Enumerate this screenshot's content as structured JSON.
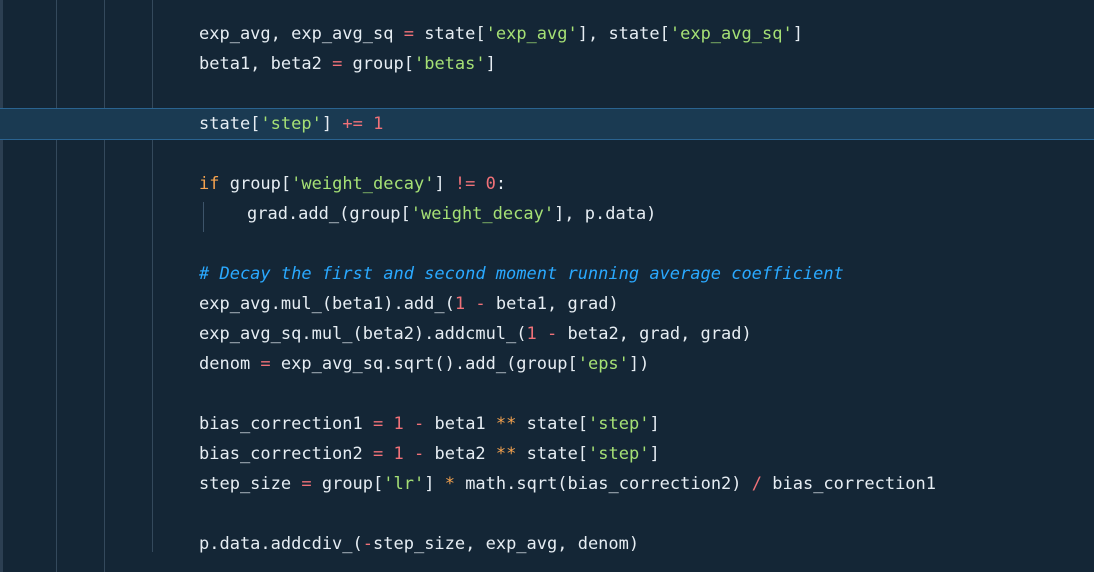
{
  "lines": [
    {
      "indent": 1,
      "tokens": [
        {
          "t": "exp_avg, exp_avg_sq ",
          "k": "plain"
        },
        {
          "t": "=",
          "k": "op"
        },
        {
          "t": " state[",
          "k": "plain"
        },
        {
          "t": "'exp_avg'",
          "k": "str"
        },
        {
          "t": "], state[",
          "k": "plain"
        },
        {
          "t": "'exp_avg_sq'",
          "k": "str"
        },
        {
          "t": "]",
          "k": "plain"
        }
      ]
    },
    {
      "indent": 1,
      "tokens": [
        {
          "t": "beta1, beta2 ",
          "k": "plain"
        },
        {
          "t": "=",
          "k": "op"
        },
        {
          "t": " group[",
          "k": "plain"
        },
        {
          "t": "'betas'",
          "k": "str"
        },
        {
          "t": "]",
          "k": "plain"
        }
      ]
    },
    {
      "indent": 1,
      "tokens": []
    },
    {
      "indent": 1,
      "active": true,
      "tokens": [
        {
          "t": "state[",
          "k": "plain"
        },
        {
          "t": "'step'",
          "k": "str"
        },
        {
          "t": "] ",
          "k": "plain"
        },
        {
          "t": "+=",
          "k": "op"
        },
        {
          "t": " ",
          "k": "plain"
        },
        {
          "t": "1",
          "k": "num"
        }
      ]
    },
    {
      "indent": 1,
      "tokens": []
    },
    {
      "indent": 1,
      "tokens": [
        {
          "t": "if",
          "k": "kw"
        },
        {
          "t": " group[",
          "k": "plain"
        },
        {
          "t": "'weight_decay'",
          "k": "str"
        },
        {
          "t": "] ",
          "k": "plain"
        },
        {
          "t": "!=",
          "k": "op"
        },
        {
          "t": " ",
          "k": "plain"
        },
        {
          "t": "0",
          "k": "num"
        },
        {
          "t": ":",
          "k": "plain"
        }
      ]
    },
    {
      "indent": 2,
      "tokens": [
        {
          "t": "grad.add_(group[",
          "k": "plain"
        },
        {
          "t": "'weight_decay'",
          "k": "str"
        },
        {
          "t": "], p.data)",
          "k": "plain"
        }
      ]
    },
    {
      "indent": 1,
      "tokens": []
    },
    {
      "indent": 1,
      "tokens": [
        {
          "t": "# Decay the first and second moment running average coefficient",
          "k": "cmt"
        }
      ]
    },
    {
      "indent": 1,
      "tokens": [
        {
          "t": "exp_avg.mul_(beta1).add_(",
          "k": "plain"
        },
        {
          "t": "1",
          "k": "num"
        },
        {
          "t": " ",
          "k": "plain"
        },
        {
          "t": "-",
          "k": "op"
        },
        {
          "t": " beta1, grad)",
          "k": "plain"
        }
      ]
    },
    {
      "indent": 1,
      "tokens": [
        {
          "t": "exp_avg_sq.mul_(beta2).addcmul_(",
          "k": "plain"
        },
        {
          "t": "1",
          "k": "num"
        },
        {
          "t": " ",
          "k": "plain"
        },
        {
          "t": "-",
          "k": "op"
        },
        {
          "t": " beta2, grad, grad)",
          "k": "plain"
        }
      ]
    },
    {
      "indent": 1,
      "tokens": [
        {
          "t": "denom ",
          "k": "plain"
        },
        {
          "t": "=",
          "k": "op"
        },
        {
          "t": " exp_avg_sq.sqrt().add_(group[",
          "k": "plain"
        },
        {
          "t": "'eps'",
          "k": "str"
        },
        {
          "t": "])",
          "k": "plain"
        }
      ]
    },
    {
      "indent": 1,
      "tokens": []
    },
    {
      "indent": 1,
      "tokens": [
        {
          "t": "bias_correction1 ",
          "k": "plain"
        },
        {
          "t": "=",
          "k": "op"
        },
        {
          "t": " ",
          "k": "plain"
        },
        {
          "t": "1",
          "k": "num"
        },
        {
          "t": " ",
          "k": "plain"
        },
        {
          "t": "-",
          "k": "op"
        },
        {
          "t": " beta1 ",
          "k": "plain"
        },
        {
          "t": "**",
          "k": "pow"
        },
        {
          "t": " state[",
          "k": "plain"
        },
        {
          "t": "'step'",
          "k": "str"
        },
        {
          "t": "]",
          "k": "plain"
        }
      ]
    },
    {
      "indent": 1,
      "tokens": [
        {
          "t": "bias_correction2 ",
          "k": "plain"
        },
        {
          "t": "=",
          "k": "op"
        },
        {
          "t": " ",
          "k": "plain"
        },
        {
          "t": "1",
          "k": "num"
        },
        {
          "t": " ",
          "k": "plain"
        },
        {
          "t": "-",
          "k": "op"
        },
        {
          "t": " beta2 ",
          "k": "plain"
        },
        {
          "t": "**",
          "k": "pow"
        },
        {
          "t": " state[",
          "k": "plain"
        },
        {
          "t": "'step'",
          "k": "str"
        },
        {
          "t": "]",
          "k": "plain"
        }
      ]
    },
    {
      "indent": 1,
      "tokens": [
        {
          "t": "step_size ",
          "k": "plain"
        },
        {
          "t": "=",
          "k": "op"
        },
        {
          "t": " group[",
          "k": "plain"
        },
        {
          "t": "'lr'",
          "k": "str"
        },
        {
          "t": "] ",
          "k": "plain"
        },
        {
          "t": "*",
          "k": "pow"
        },
        {
          "t": " math.sqrt(bias_correction2) ",
          "k": "plain"
        },
        {
          "t": "/",
          "k": "op"
        },
        {
          "t": " bias_correction1",
          "k": "plain"
        }
      ]
    },
    {
      "indent": 1,
      "tokens": []
    },
    {
      "indent": 1,
      "tokens": [
        {
          "t": "p.data.addcdiv_(",
          "k": "plain"
        },
        {
          "t": "-",
          "k": "op"
        },
        {
          "t": "step_size, exp_avg, denom)",
          "k": "plain"
        }
      ]
    }
  ]
}
